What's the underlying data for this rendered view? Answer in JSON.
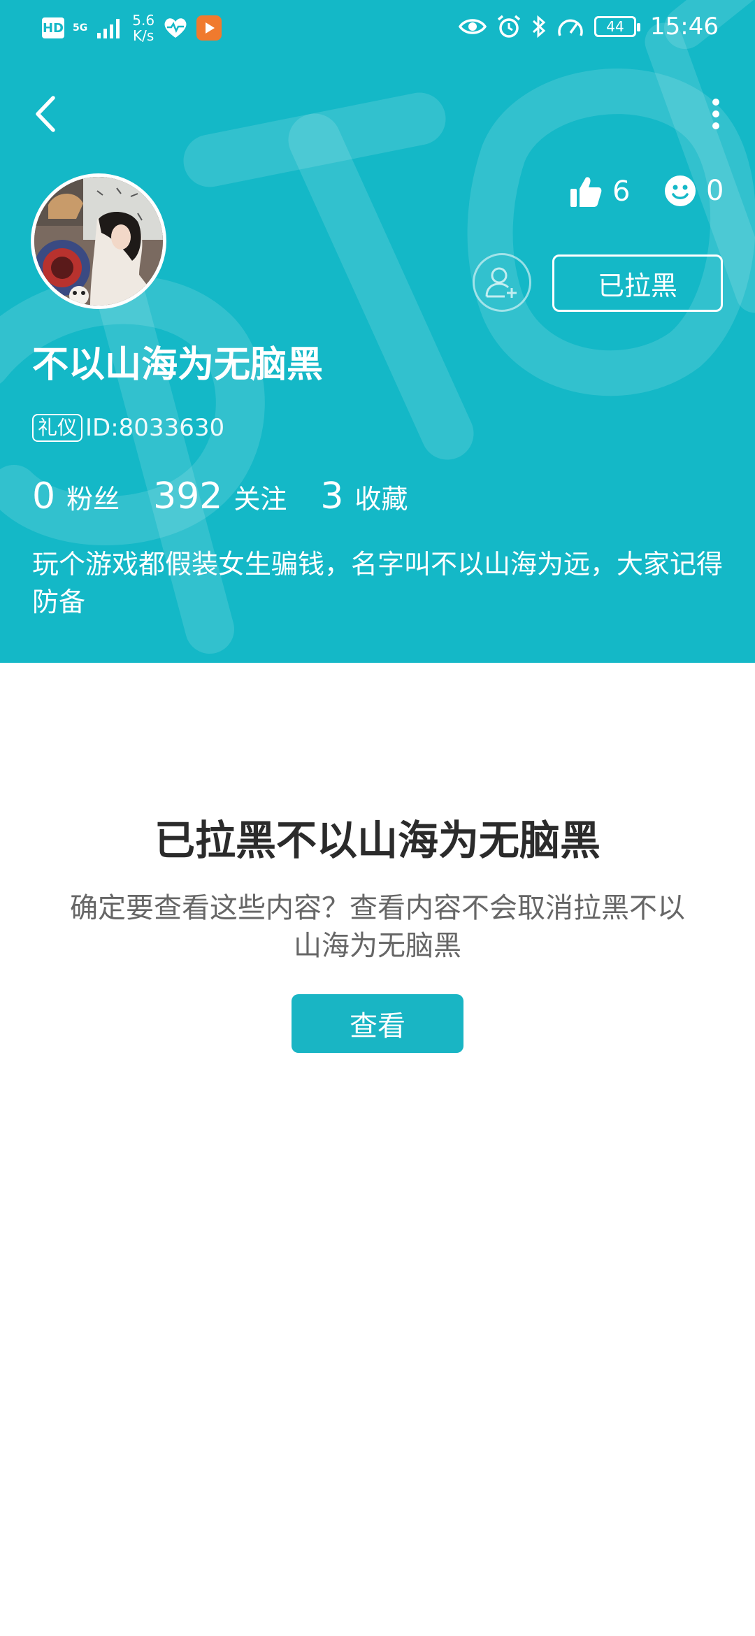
{
  "status_bar": {
    "hd": "HD",
    "network": "5G",
    "speed_value": "5.6",
    "speed_unit": "K/s",
    "battery": "44",
    "time": "15:46"
  },
  "profile": {
    "name": "不以山海为无脑黑",
    "badge": "礼仪",
    "id_text": "ID:8033630",
    "likes": "6",
    "smiles": "0",
    "blocked_label": "已拉黑",
    "fans_count": "0",
    "fans_label": "粉丝",
    "following_count": "392",
    "following_label": "关注",
    "favorites_count": "3",
    "favorites_label": "收藏",
    "bio": "玩个游戏都假装女生骗钱，名字叫不以山海为远，大家记得防备"
  },
  "notice": {
    "title": "已拉黑不以山海为无脑黑",
    "message": "确定要查看这些内容？查看内容不会取消拉黑不以山海为无脑黑",
    "view_button": "查看"
  },
  "colors": {
    "header_bg": "#14b8c7",
    "button_bg": "#19b5c4",
    "title_text": "#2b2b2b",
    "body_text": "#666666"
  },
  "icons": [
    "back-arrow-icon",
    "more-vertical-icon",
    "thumbs-up-icon",
    "smiley-icon",
    "add-friend-icon",
    "signal-icon",
    "heart-rate-icon",
    "eye-icon",
    "alarm-icon",
    "bluetooth-icon",
    "speedometer-icon"
  ]
}
